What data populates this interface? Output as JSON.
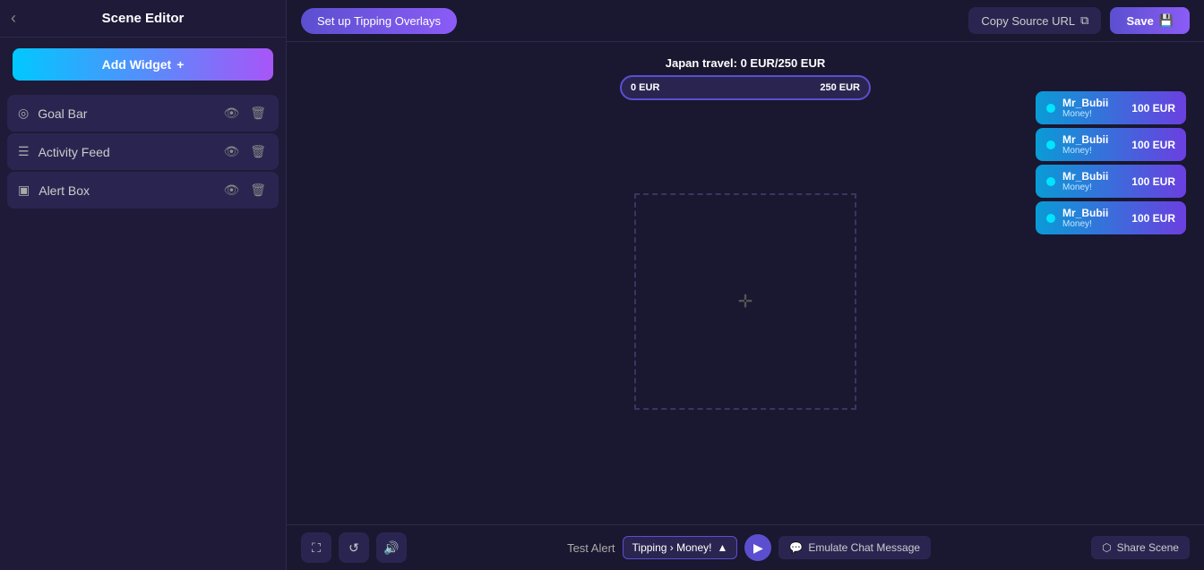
{
  "sidebar": {
    "title": "Scene Editor",
    "back_icon": "‹",
    "add_widget_label": "Add Widget",
    "add_icon": "+",
    "widgets": [
      {
        "id": "goal-bar",
        "label": "Goal Bar",
        "icon": "◎"
      },
      {
        "id": "activity-feed",
        "label": "Activity Feed",
        "icon": "☰"
      },
      {
        "id": "alert-box",
        "label": "Alert Box",
        "icon": "▣"
      }
    ]
  },
  "header": {
    "tipping_overlays_label": "Set up Tipping Overlays",
    "copy_source_url_label": "Copy Source URL",
    "copy_icon": "⧉",
    "save_label": "Save",
    "save_icon": "💾"
  },
  "goal_bar": {
    "title": "Japan travel: 0 EUR/250 EUR",
    "left_label": "0 EUR",
    "right_label": "250 EUR",
    "fill_percent": 0
  },
  "activity_feed": {
    "cards": [
      {
        "name": "Mr_Bubii",
        "message": "Money!",
        "amount": "100 EUR"
      },
      {
        "name": "Mr_Bubii",
        "message": "Money!",
        "amount": "100 EUR"
      },
      {
        "name": "Mr_Bubii",
        "message": "Money!",
        "amount": "100 EUR"
      },
      {
        "name": "Mr_Bubii",
        "message": "Money!",
        "amount": "100 EUR"
      }
    ]
  },
  "footer": {
    "resize_icon": "⛶",
    "reset_icon": "↺",
    "mute_icon": "🔊",
    "test_alert_label": "Test Alert",
    "test_alert_dropdown": "Tipping › Money!",
    "dropdown_icon": "▲",
    "send_icon": "▶",
    "emulate_chat_icon": "💬",
    "emulate_chat_label": "Emulate Chat Message",
    "share_icon": "⬡",
    "share_label": "Share Scene"
  }
}
